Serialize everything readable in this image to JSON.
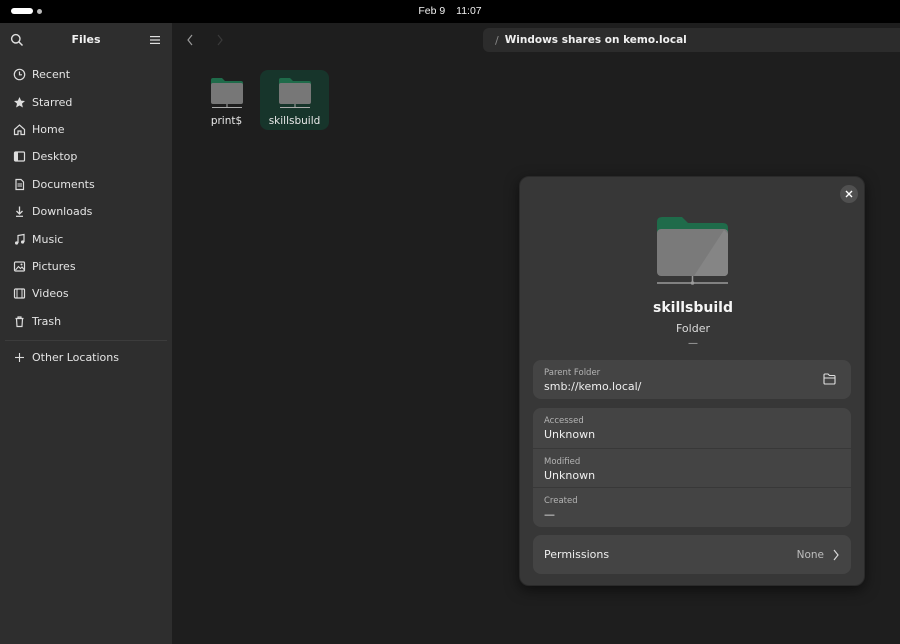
{
  "topbar": {
    "date": "Feb 9",
    "time": "11:07"
  },
  "sidebar": {
    "title": "Files",
    "items": [
      {
        "label": "Recent",
        "icon": "clock-icon"
      },
      {
        "label": "Starred",
        "icon": "star-icon"
      },
      {
        "label": "Home",
        "icon": "home-icon"
      },
      {
        "label": "Desktop",
        "icon": "desktop-icon"
      },
      {
        "label": "Documents",
        "icon": "document-icon"
      },
      {
        "label": "Downloads",
        "icon": "download-icon"
      },
      {
        "label": "Music",
        "icon": "music-icon"
      },
      {
        "label": "Pictures",
        "icon": "picture-icon"
      },
      {
        "label": "Videos",
        "icon": "video-icon"
      },
      {
        "label": "Trash",
        "icon": "trash-icon"
      }
    ],
    "other_locations": "Other Locations"
  },
  "pathbar": {
    "location": "Windows shares on kemo.local"
  },
  "files": [
    {
      "name": "print$",
      "selected": false
    },
    {
      "name": "skillsbuild",
      "selected": true
    }
  ],
  "properties": {
    "name": "skillsbuild",
    "type": "Folder",
    "size": "—",
    "parent_folder_label": "Parent Folder",
    "parent_folder_value": "smb://kemo.local/",
    "accessed_label": "Accessed",
    "accessed_value": "Unknown",
    "modified_label": "Modified",
    "modified_value": "Unknown",
    "created_label": "Created",
    "created_value": "—",
    "permissions_label": "Permissions",
    "permissions_value": "None"
  },
  "colors": {
    "accent_green": "#2a7a55",
    "selection": "#17352b"
  }
}
